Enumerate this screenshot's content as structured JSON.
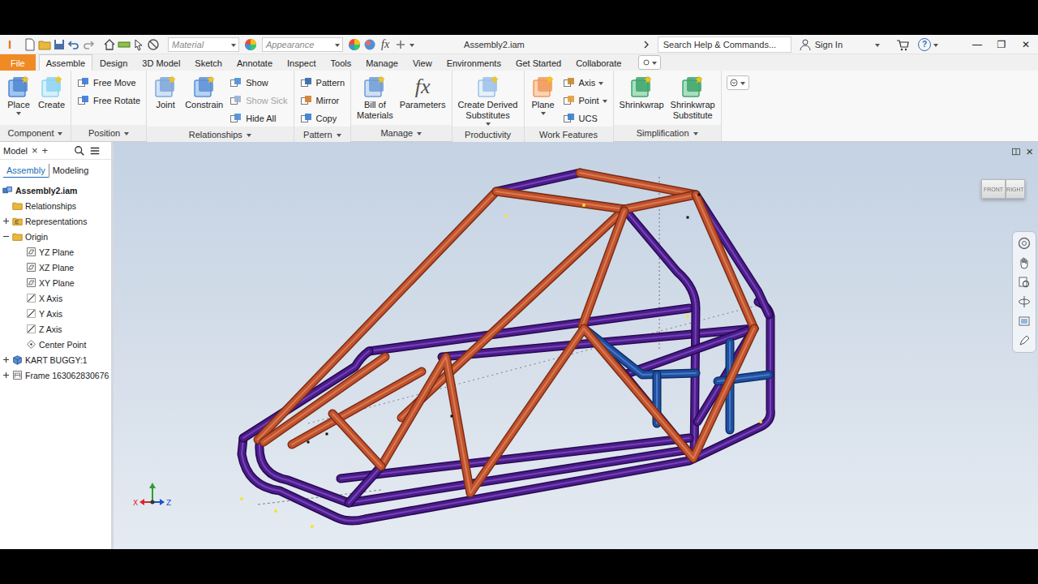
{
  "window": {
    "title": "Assembly2.iam",
    "controls": [
      "—",
      "❐",
      "✕"
    ]
  },
  "app": {
    "logo": "I"
  },
  "quick_access": {
    "material": "Material",
    "appearance": "Appearance",
    "fx": "fx"
  },
  "search": {
    "placeholder": "Search Help & Commands..."
  },
  "account": {
    "label": "Sign In"
  },
  "help": "?",
  "tabs": [
    {
      "label": "File",
      "selected": false,
      "kind": "file"
    },
    {
      "label": "Assemble",
      "selected": true,
      "kind": "tab"
    },
    {
      "label": "Design",
      "selected": false,
      "kind": "tab"
    },
    {
      "label": "3D Model",
      "selected": false,
      "kind": "tab"
    },
    {
      "label": "Sketch",
      "selected": false,
      "kind": "tab"
    },
    {
      "label": "Annotate",
      "selected": false,
      "kind": "tab"
    },
    {
      "label": "Inspect",
      "selected": false,
      "kind": "tab"
    },
    {
      "label": "Tools",
      "selected": false,
      "kind": "tab"
    },
    {
      "label": "Manage",
      "selected": false,
      "kind": "tab"
    },
    {
      "label": "View",
      "selected": false,
      "kind": "tab"
    },
    {
      "label": "Environments",
      "selected": false,
      "kind": "tab"
    },
    {
      "label": "Get Started",
      "selected": false,
      "kind": "tab"
    },
    {
      "label": "Collaborate",
      "selected": false,
      "kind": "tab"
    }
  ],
  "ribbon": {
    "panels": [
      {
        "label": "Component",
        "menu": true,
        "groups": [
          {
            "kind": "large",
            "items": [
              {
                "lines": [
                  "Place"
                ],
                "dropdown": true,
                "disabled": false,
                "glyph": ""
              },
              {
                "lines": [
                  "Create"
                ],
                "dropdown": false,
                "disabled": false,
                "glyph": ""
              }
            ]
          }
        ]
      },
      {
        "label": "Position",
        "menu": true,
        "groups": [
          {
            "kind": "small",
            "items": [
              {
                "label": "Free Move",
                "dropdown": false,
                "disabled": false
              },
              {
                "label": "Free Rotate",
                "dropdown": false,
                "disabled": false
              }
            ]
          }
        ]
      },
      {
        "label": "Relationships",
        "menu": true,
        "groups": [
          {
            "kind": "large",
            "items": [
              {
                "lines": [
                  "Joint"
                ],
                "dropdown": false,
                "disabled": false,
                "glyph": ""
              },
              {
                "lines": [
                  "Constrain"
                ],
                "dropdown": false,
                "disabled": false,
                "glyph": ""
              }
            ]
          },
          {
            "kind": "small",
            "items": [
              {
                "label": "Show",
                "dropdown": false,
                "disabled": false
              },
              {
                "label": "Show Sick",
                "dropdown": false,
                "disabled": true
              },
              {
                "label": "Hide All",
                "dropdown": false,
                "disabled": false
              }
            ]
          }
        ]
      },
      {
        "label": "Pattern",
        "menu": true,
        "groups": [
          {
            "kind": "small",
            "items": [
              {
                "label": "Pattern",
                "dropdown": false,
                "disabled": false
              },
              {
                "label": "Mirror",
                "dropdown": false,
                "disabled": false
              },
              {
                "label": "Copy",
                "dropdown": false,
                "disabled": false
              }
            ]
          }
        ]
      },
      {
        "label": "Manage",
        "menu": true,
        "groups": [
          {
            "kind": "large",
            "items": [
              {
                "lines": [
                  "Bill of",
                  "Materials"
                ],
                "dropdown": false,
                "disabled": false,
                "glyph": ""
              },
              {
                "lines": [
                  "Parameters"
                ],
                "dropdown": false,
                "disabled": false,
                "glyph": "fx"
              }
            ]
          }
        ]
      },
      {
        "label": "Productivity",
        "menu": false,
        "groups": [
          {
            "kind": "large",
            "items": [
              {
                "lines": [
                  "Create Derived",
                  "Substitutes"
                ],
                "dropdown": true,
                "disabled": false,
                "glyph": ""
              }
            ]
          }
        ]
      },
      {
        "label": "Work Features",
        "menu": false,
        "groups": [
          {
            "kind": "large",
            "items": [
              {
                "lines": [
                  "Plane"
                ],
                "dropdown": true,
                "disabled": false,
                "glyph": ""
              }
            ]
          },
          {
            "kind": "small",
            "items": [
              {
                "label": "Axis",
                "dropdown": true,
                "disabled": false
              },
              {
                "label": "Point",
                "dropdown": true,
                "disabled": false
              },
              {
                "label": "UCS",
                "dropdown": false,
                "disabled": false
              }
            ]
          }
        ]
      },
      {
        "label": "Simplification",
        "menu": true,
        "groups": [
          {
            "kind": "large",
            "items": [
              {
                "lines": [
                  "Shrinkwrap"
                ],
                "dropdown": false,
                "disabled": false,
                "glyph": ""
              },
              {
                "lines": [
                  "Shrinkwrap",
                  "Substitute"
                ],
                "dropdown": false,
                "disabled": false,
                "glyph": ""
              }
            ]
          }
        ]
      }
    ]
  },
  "browser": {
    "title": "Model",
    "close": "×",
    "add": "+",
    "tabs": [
      {
        "label": "Assembly",
        "selected": true
      },
      {
        "label": "Modeling",
        "selected": false
      }
    ],
    "tree": [
      {
        "label": "Assembly2.iam",
        "depth": 0,
        "kind": "assembly",
        "expandable": false,
        "expanded": false
      },
      {
        "label": "Relationships",
        "depth": 1,
        "kind": "folder",
        "expandable": false,
        "expanded": false
      },
      {
        "label": "Representations",
        "depth": 1,
        "kind": "representations",
        "expandable": true,
        "expanded": false
      },
      {
        "label": "Origin",
        "depth": 1,
        "kind": "folder",
        "expandable": true,
        "expanded": true
      },
      {
        "label": "YZ Plane",
        "depth": 2,
        "kind": "plane",
        "expandable": false,
        "expanded": false
      },
      {
        "label": "XZ Plane",
        "depth": 2,
        "kind": "plane",
        "expandable": false,
        "expanded": false
      },
      {
        "label": "XY Plane",
        "depth": 2,
        "kind": "plane",
        "expandable": false,
        "expanded": false
      },
      {
        "label": "X Axis",
        "depth": 2,
        "kind": "axis",
        "expandable": false,
        "expanded": false
      },
      {
        "label": "Y Axis",
        "depth": 2,
        "kind": "axis",
        "expandable": false,
        "expanded": false
      },
      {
        "label": "Z Axis",
        "depth": 2,
        "kind": "axis",
        "expandable": false,
        "expanded": false
      },
      {
        "label": "Center Point",
        "depth": 2,
        "kind": "point",
        "expandable": false,
        "expanded": false
      },
      {
        "label": "KART BUGGY:1",
        "depth": 1,
        "kind": "part",
        "expandable": true,
        "expanded": false
      },
      {
        "label": "Frame 163062830676",
        "depth": 1,
        "kind": "frame",
        "expandable": true,
        "expanded": false
      }
    ]
  },
  "viewport": {
    "close": "×",
    "viewcube": {
      "front": "FRONT",
      "right": "RIGHT"
    },
    "triad": {
      "x": "X",
      "z": "Z"
    }
  }
}
